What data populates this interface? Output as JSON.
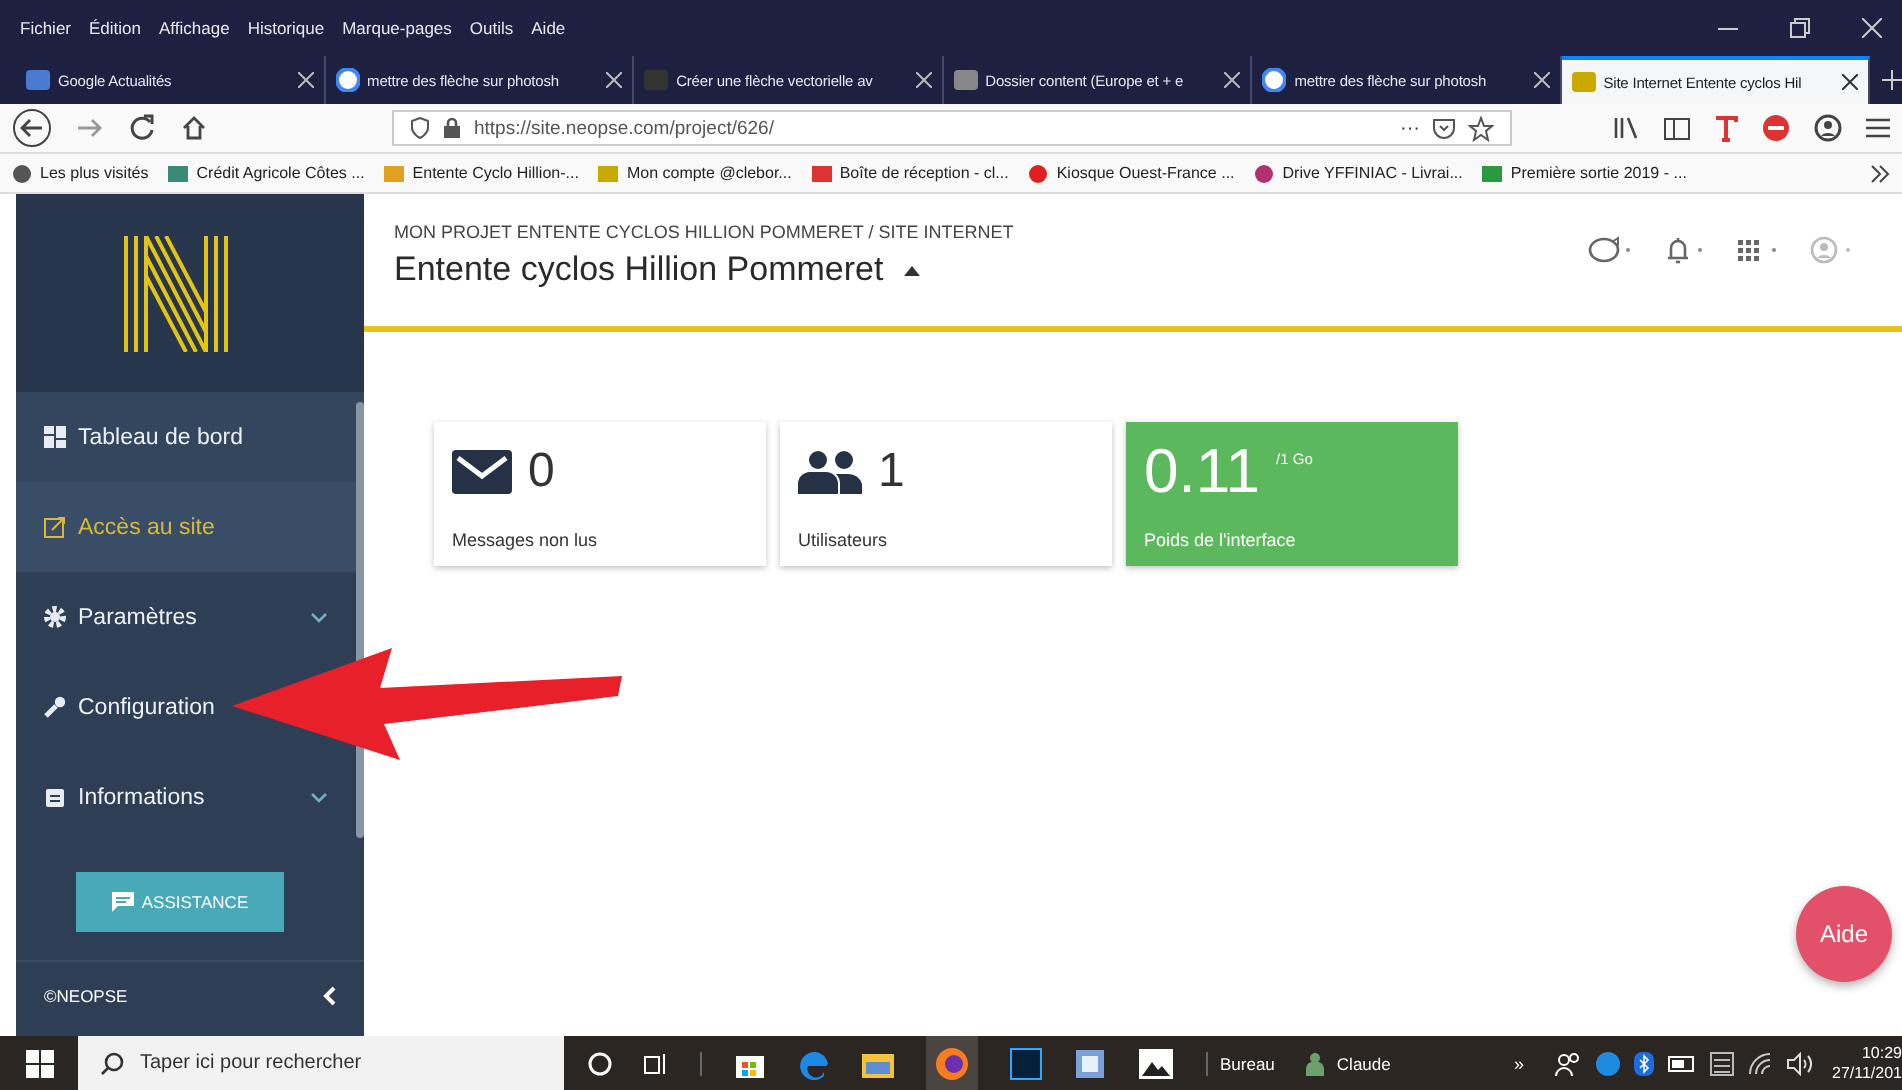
{
  "menu_bar": [
    "Fichier",
    "Édition",
    "Affichage",
    "Historique",
    "Marque-pages",
    "Outils",
    "Aide"
  ],
  "tabs": [
    {
      "title": "Google Actualités",
      "kind": "news",
      "selected": false
    },
    {
      "title": "mettre des flèche sur photosh",
      "kind": "google",
      "selected": false
    },
    {
      "title": "Créer une flèche vectorielle av",
      "kind": "fc",
      "selected": false
    },
    {
      "title": "Dossier content (Europe et + e",
      "kind": "doc",
      "selected": false
    },
    {
      "title": "mettre des flèche sur photosh",
      "kind": "google",
      "selected": false
    },
    {
      "title": "Site Internet Entente cyclos Hil",
      "kind": "neopse",
      "selected": true
    }
  ],
  "address_bar": {
    "url": "https://site.neopse.com/project/626/",
    "more": "···"
  },
  "bookmarks": [
    {
      "label": "Les plus visités",
      "kind": "gear"
    },
    {
      "label": "Crédit Agricole Côtes ...",
      "kind": "bank"
    },
    {
      "label": "Entente Cyclo Hillion-...",
      "kind": "dots"
    },
    {
      "label": "Mon compte @clebor...",
      "kind": "neopse"
    },
    {
      "label": "Boîte de réception - cl...",
      "kind": "mail"
    },
    {
      "label": "Kiosque Ouest-France ...",
      "kind": "red"
    },
    {
      "label": "Drive YFFINIAC - Livrai...",
      "kind": "drive"
    },
    {
      "label": "Première sortie 2019 - ...",
      "kind": "green"
    }
  ],
  "sidebar": {
    "items": [
      {
        "label": "Tableau de bord",
        "kind": "dashboard",
        "selected": false,
        "submenu": false
      },
      {
        "label": "Accès au site",
        "kind": "external",
        "selected": true,
        "submenu": false
      },
      {
        "label": "Paramètres",
        "kind": "gear",
        "selected": false,
        "submenu": true
      },
      {
        "label": "Configuration",
        "kind": "wrench",
        "selected": false,
        "submenu": false
      },
      {
        "label": "Informations",
        "kind": "calendar",
        "selected": false,
        "submenu": true
      }
    ],
    "assistance_button": "ASSISTANCE",
    "footer": "©NEOPSE"
  },
  "header": {
    "breadcrumb": "MON PROJET ENTENTE CYCLOS HILLION POMMERET / SITE INTERNET",
    "title": "Entente cyclos Hillion Pommeret"
  },
  "cards": [
    {
      "kind": "messages",
      "value": "0",
      "label": "Messages non lus"
    },
    {
      "kind": "users",
      "value": "1",
      "label": "Utilisateurs"
    },
    {
      "kind": "storage",
      "value": "0.11",
      "unit": "/1 Go",
      "label": "Poids de l'interface"
    }
  ],
  "help_button": "Aide",
  "taskbar": {
    "search_placeholder": "Taper ici pour rechercher",
    "toolbar_label": "Bureau",
    "user": "Claude",
    "more": "»",
    "time": "10:29",
    "date": "27/11/201"
  }
}
